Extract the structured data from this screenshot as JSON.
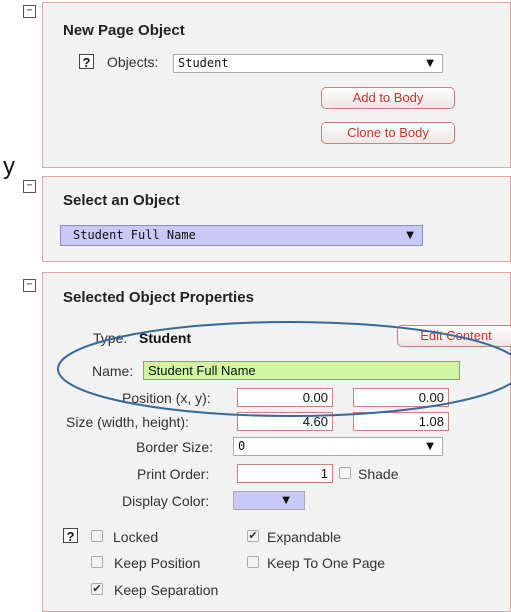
{
  "panels": {
    "new_page_object": {
      "collapse": "−",
      "title": "New Page Object",
      "help": "?",
      "objects_label": "Objects:",
      "objects_value": "Student",
      "add_to_body": "Add to Body",
      "clone_to_body": "Clone to Body"
    },
    "select_object": {
      "collapse": "−",
      "title": "Select an Object",
      "value": "Student Full Name",
      "accent": "#c9c9f7"
    },
    "properties": {
      "collapse": "−",
      "title": "Selected Object Properties",
      "type_label": "Type:",
      "type_value": "Student",
      "edit_content": "Edit Content",
      "name_label": "Name:",
      "name_value": "Student Full Name",
      "name_bg": "#ccf7a0",
      "position_label": "Position (x, y):",
      "pos_x": "0.00",
      "pos_y": "0.00",
      "size_label": "Size (width, height):",
      "width": "4.60",
      "height": "1.08",
      "border_label": "Border Size:",
      "border_value": "0",
      "print_order_label": "Print Order:",
      "print_order_value": "1",
      "shade_label": "Shade",
      "display_color_label": "Display Color:",
      "display_color": "#c9c9f7",
      "help": "?",
      "locked_label": "Locked",
      "expandable_label": "Expandable",
      "keep_position_label": "Keep Position",
      "keep_one_page_label": "Keep To One Page",
      "keep_separation_label": "Keep Separation",
      "check_mark": "✔",
      "checks": {
        "locked": false,
        "expandable": true,
        "keep_position": false,
        "keep_one_page": false,
        "keep_separation": true,
        "shade": false
      }
    }
  },
  "overlay": {
    "stray_text": "y",
    "ellipse_color": "#3a6a9c"
  }
}
